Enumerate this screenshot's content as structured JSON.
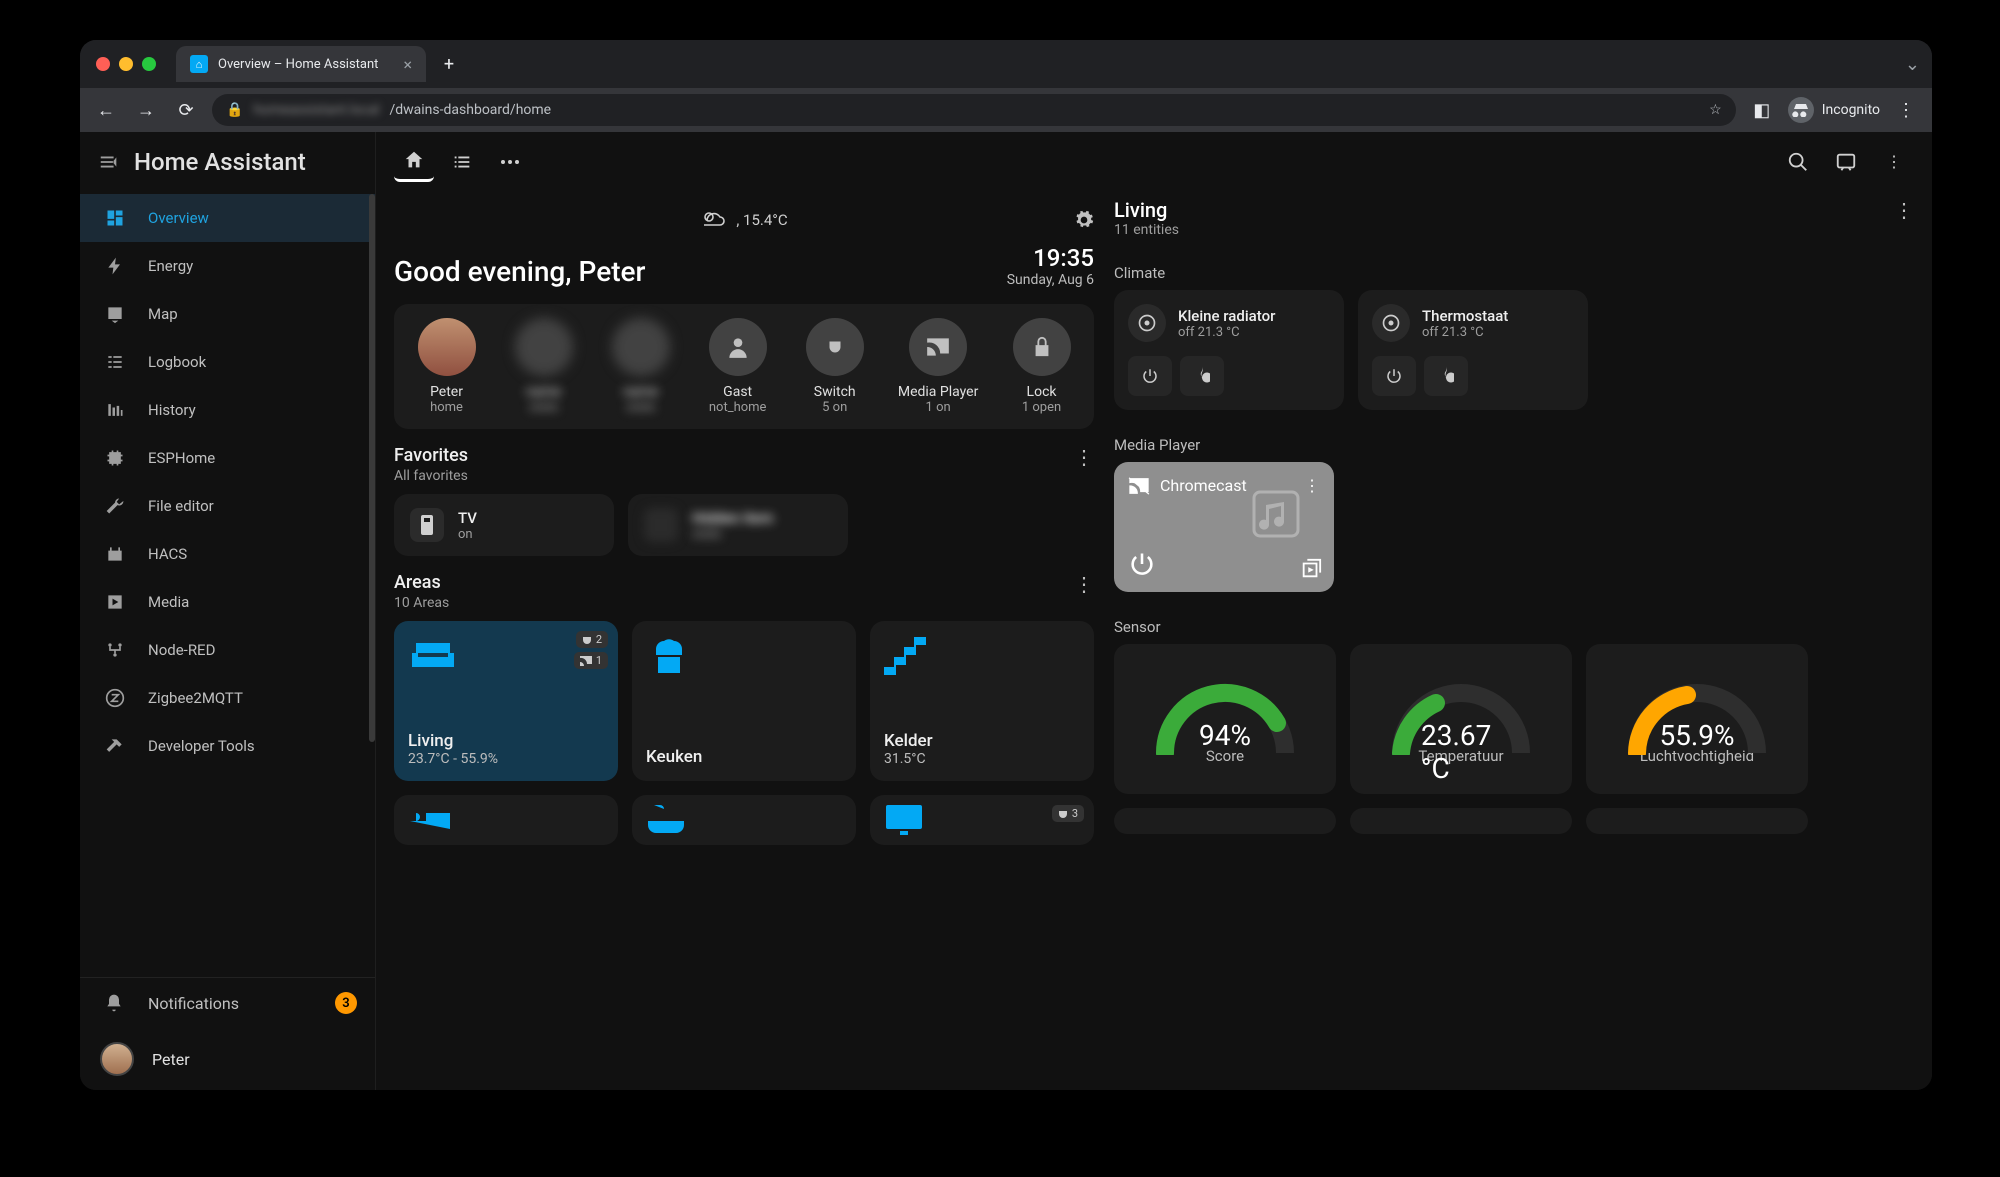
{
  "browser": {
    "tab_title": "Overview – Home Assistant",
    "url_prefix_blurred": "homeassistant.local",
    "url_path": "/dwains-dashboard/home",
    "incognito_label": "Incognito"
  },
  "sidebar": {
    "title": "Home Assistant",
    "items": [
      {
        "label": "Overview",
        "icon": "dashboard",
        "active": true
      },
      {
        "label": "Energy",
        "icon": "bolt"
      },
      {
        "label": "Map",
        "icon": "map"
      },
      {
        "label": "Logbook",
        "icon": "logbook"
      },
      {
        "label": "History",
        "icon": "history"
      },
      {
        "label": "ESPHome",
        "icon": "chip"
      },
      {
        "label": "File editor",
        "icon": "wrench"
      },
      {
        "label": "HACS",
        "icon": "hacs"
      },
      {
        "label": "Media",
        "icon": "media"
      },
      {
        "label": "Node-RED",
        "icon": "nodered"
      },
      {
        "label": "Zigbee2MQTT",
        "icon": "zigbee"
      },
      {
        "label": "Developer Tools",
        "icon": "hammer"
      }
    ],
    "notifications": {
      "label": "Notifications",
      "count": "3"
    },
    "user": {
      "name": "Peter"
    }
  },
  "header": {
    "weather_temp": ", 15.4°C",
    "greeting": "Good evening, Peter",
    "time": "19:35",
    "date": "Sunday, Aug 6"
  },
  "chips": [
    {
      "name": "Peter",
      "state": "home",
      "icon": "photo"
    },
    {
      "name": "",
      "state": "",
      "icon": "blur"
    },
    {
      "name": "",
      "state": "",
      "icon": "blur"
    },
    {
      "name": "Gast",
      "state": "not_home",
      "icon": "person"
    },
    {
      "name": "Switch",
      "state": "5 on",
      "icon": "plug"
    },
    {
      "name": "Media Player",
      "state": "1 on",
      "icon": "cast"
    },
    {
      "name": "Lock",
      "state": "1 open",
      "icon": "lock"
    }
  ],
  "favorites": {
    "title": "Favorites",
    "subtitle": "All favorites",
    "items": [
      {
        "name": "TV",
        "state": "on",
        "icon": "remote"
      },
      {
        "name": "",
        "state": "",
        "blur": true
      }
    ]
  },
  "areas": {
    "title": "Areas",
    "subtitle": "10 Areas",
    "items": [
      {
        "name": "Living",
        "state": "23.7°C - 55.9%",
        "icon": "sofa",
        "active": true,
        "tags": [
          {
            "ic": "plug",
            "n": "2"
          },
          {
            "ic": "cast",
            "n": "1"
          }
        ]
      },
      {
        "name": "Keuken",
        "state": "",
        "icon": "chef"
      },
      {
        "name": "Kelder",
        "state": "31.5°C",
        "icon": "stairs"
      },
      {
        "name": "",
        "state": "",
        "icon": "bed"
      },
      {
        "name": "",
        "state": "",
        "icon": "bath"
      },
      {
        "name": "",
        "state": "",
        "icon": "screen",
        "tags": [
          {
            "ic": "plug",
            "n": "3"
          }
        ]
      }
    ]
  },
  "living": {
    "title": "Living",
    "subtitle": "11 entities",
    "climate_title": "Climate",
    "climates": [
      {
        "name": "Kleine radiator",
        "state": "off 21.3 °C"
      },
      {
        "name": "Thermostaat",
        "state": "off 21.3 °C"
      }
    ],
    "media_title": "Media Player",
    "media": {
      "name": "Chromecast"
    },
    "sensor_title": "Sensor",
    "sensors": [
      {
        "value": "94%",
        "name": "Score",
        "color": "#3bab3a",
        "fill": 0.85
      },
      {
        "value": "23.67 °C",
        "name": "Temperatuur",
        "color": "#3bab3a",
        "fill": 0.4
      },
      {
        "value": "55.9%",
        "name": "Luchtvochtigheid",
        "color": "#ffa600",
        "fill": 0.45
      }
    ]
  }
}
